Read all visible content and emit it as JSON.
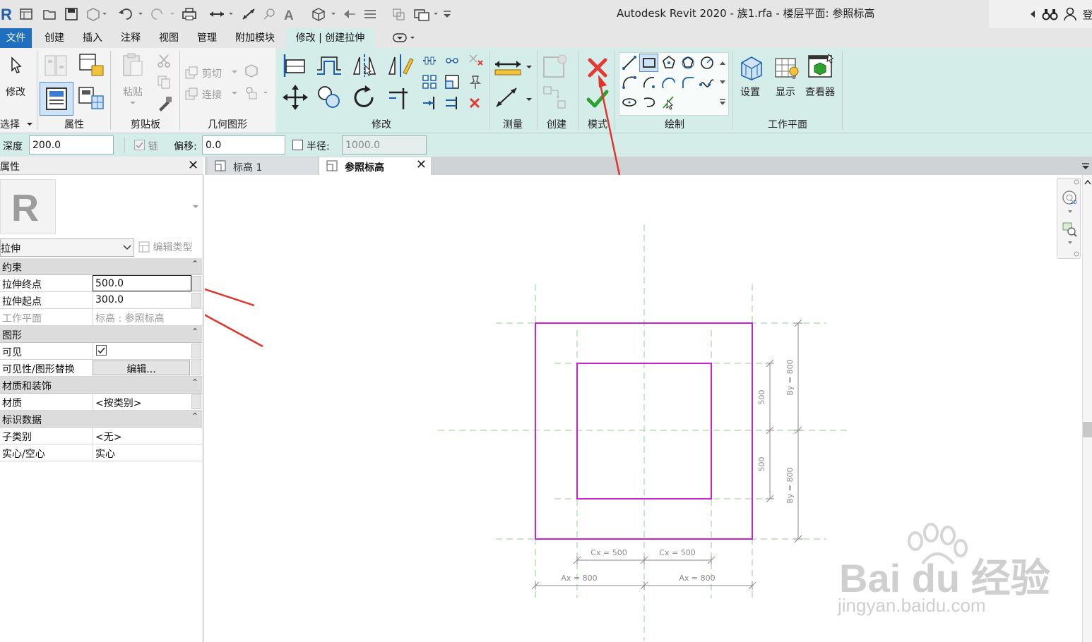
{
  "app": {
    "title": "Autodesk Revit 2020 - 族1.rfa - 楼层平面: 参照标高",
    "sign_in": "登"
  },
  "ribbon_tabs": [
    {
      "label": "文件"
    },
    {
      "label": "创建"
    },
    {
      "label": "插入"
    },
    {
      "label": "注释"
    },
    {
      "label": "视图"
    },
    {
      "label": "管理"
    },
    {
      "label": "附加模块"
    },
    {
      "label": "修改 | 创建拉伸"
    }
  ],
  "ribbon": {
    "modify_label": "修改",
    "select_label": "选择",
    "properties_label": "属性",
    "clipboard_label": "剪贴板",
    "paste_label": "粘贴",
    "cut_label": "剪切",
    "join_label": "连接",
    "geometry_label": "几何图形",
    "modify_panel_label": "修改",
    "measure_label": "测量",
    "create_label": "创建",
    "mode_label": "模式",
    "draw_label": "绘制",
    "setup_label": "设置",
    "show_label": "显示",
    "viewer_label": "查看器",
    "workplane_label": "工作平面",
    "colors": {
      "finish": "#2ea12e",
      "cancel": "#e53935"
    }
  },
  "options_bar": {
    "depth_label": "深度",
    "depth_value": "200.0",
    "chain_label": "链",
    "offset_label": "偏移:",
    "offset_value": "0.0",
    "radius_label": "半径:",
    "radius_value": "1000.0"
  },
  "properties": {
    "title": "属性",
    "type_name": "拉伸",
    "edit_type": "编辑类型",
    "groups": {
      "constraints": "约束",
      "graphics": "图形",
      "materials": "材质和装饰",
      "identity": "标识数据"
    },
    "rows": {
      "extrusion_end": {
        "label": "拉伸终点",
        "value": "500.0"
      },
      "extrusion_start": {
        "label": "拉伸起点",
        "value": "300.0"
      },
      "work_plane": {
        "label": "工作平面",
        "value": "标高 : 参照标高"
      },
      "visible": {
        "label": "可见",
        "checked": true
      },
      "vis_override": {
        "label": "可见性/图形替换",
        "value": "编辑..."
      },
      "material": {
        "label": "材质",
        "value": "<按类别>"
      },
      "subcategory": {
        "label": "子类别",
        "value": "<无>"
      },
      "solid_void": {
        "label": "实心/空心",
        "value": "实心"
      }
    }
  },
  "view_tabs": [
    {
      "label": "标高 1",
      "active": false
    },
    {
      "label": "参照标高",
      "active": true
    }
  ],
  "drawing": {
    "sketch_color": "#cc22cc",
    "dimensions": {
      "cx_left": "Cx = 500",
      "cx_right": "Cx = 500",
      "ax_left": "Ax = 800",
      "ax_right": "Ax = 800",
      "right_inner_top": "500",
      "right_inner_bottom": "500",
      "by_top": "By = 800",
      "by_bottom": "By = 800"
    }
  },
  "watermark": {
    "brand": "Bai du 经验",
    "url": "jingyan.baidu.com"
  }
}
